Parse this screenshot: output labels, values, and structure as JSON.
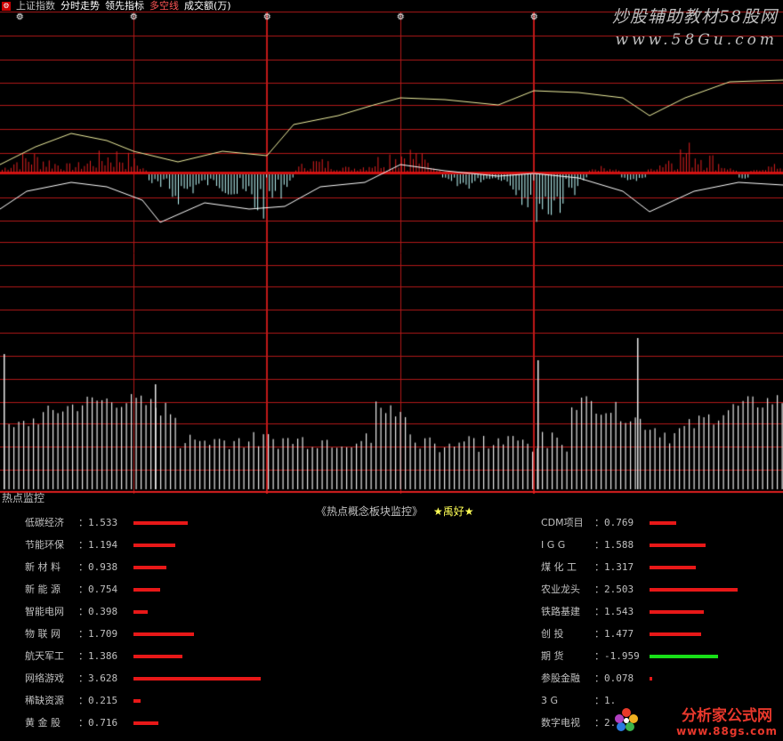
{
  "topbar": {
    "icon": "settings-icon",
    "items": [
      "上证指数",
      "分时走势",
      "领先指标",
      "多空线",
      "成交额(万)"
    ],
    "colors": [
      "#c0c0c0",
      "#ffffff",
      "#ffffff",
      "#ff5555",
      "#ffffff"
    ]
  },
  "watermark": {
    "line1": "炒股辅助教材58股网",
    "line2": "www.58Gu.com"
  },
  "panel": {
    "label": "热点监控",
    "title": "《热点概念板块监控》",
    "star_text": "★禹好★"
  },
  "colors": {
    "grid": "#b01818",
    "positive_bar": "#e81818",
    "negative_bar": "#18e018",
    "background": "#000000"
  },
  "left_items": [
    {
      "name": "低碳经济",
      "value": "1.533",
      "num": 1.533
    },
    {
      "name": "节能环保",
      "value": "1.194",
      "num": 1.194
    },
    {
      "name": "新 材 料",
      "value": "0.938",
      "num": 0.938
    },
    {
      "name": "新 能 源",
      "value": "0.754",
      "num": 0.754
    },
    {
      "name": "智能电网",
      "value": "0.398",
      "num": 0.398
    },
    {
      "name": "物 联 网",
      "value": "1.709",
      "num": 1.709
    },
    {
      "name": "航天军工",
      "value": "1.386",
      "num": 1.386
    },
    {
      "name": "网络游戏",
      "value": "3.628",
      "num": 3.628
    },
    {
      "name": "稀缺资源",
      "value": "0.215",
      "num": 0.215
    },
    {
      "name": "黄 金 股",
      "value": "0.716",
      "num": 0.716
    }
  ],
  "right_items": [
    {
      "name": "CDM项目",
      "value": "0.769",
      "num": 0.769
    },
    {
      "name": "I G G",
      "value": "1.588",
      "num": 1.588
    },
    {
      "name": "煤 化 工",
      "value": "1.317",
      "num": 1.317
    },
    {
      "name": "农业龙头",
      "value": "2.503",
      "num": 2.503
    },
    {
      "name": "铁路基建",
      "value": "1.543",
      "num": 1.543
    },
    {
      "name": "创  投",
      "value": "1.477",
      "num": 1.477
    },
    {
      "name": "期  货",
      "value": "-1.959",
      "num": -1.959
    },
    {
      "name": "参股金融",
      "value": "0.078",
      "num": 0.078
    },
    {
      "name": "3 G",
      "value": "1.",
      "num": null
    },
    {
      "name": "数字电视",
      "value": "2.",
      "num": null
    }
  ],
  "logo": {
    "line1": "分析家公式网",
    "line2": "www.88gs.com"
  }
}
